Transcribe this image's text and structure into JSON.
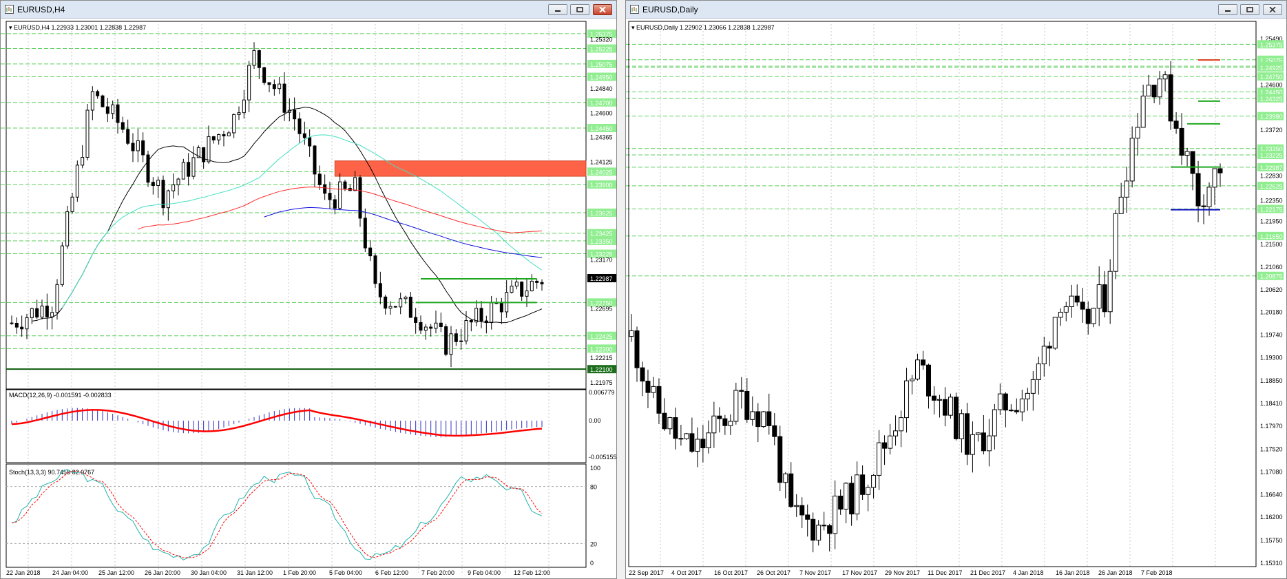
{
  "left_window": {
    "title": "EURUSD,H4",
    "header": "EURUSD,H4  1.22933 1.23001 1.22838 1.22987",
    "price_labels": [
      {
        "v": 1.2537,
        "t": "1.25375",
        "hl": true
      },
      {
        "v": 1.2532,
        "t": "1.25320",
        "hl": false
      },
      {
        "v": 1.25225,
        "t": "1.25225",
        "hl": true
      },
      {
        "v": 1.25075,
        "t": "1.25075",
        "hl": true
      },
      {
        "v": 1.2495,
        "t": "1.24950",
        "hl": true
      },
      {
        "v": 1.2484,
        "t": "1.24840",
        "hl": false
      },
      {
        "v": 1.247,
        "t": "1.24700",
        "hl": true
      },
      {
        "v": 1.246,
        "t": "1.24600",
        "hl": false
      },
      {
        "v": 1.2445,
        "t": "1.24450",
        "hl": true
      },
      {
        "v": 1.24365,
        "t": "1.24365",
        "hl": false
      },
      {
        "v": 1.24125,
        "t": "1.24125",
        "hl": false
      },
      {
        "v": 1.24025,
        "t": "1.24025",
        "hl": true
      },
      {
        "v": 1.239,
        "t": "1.23900",
        "hl": true
      },
      {
        "v": 1.23625,
        "t": "1.23625",
        "hl": true
      },
      {
        "v": 1.23425,
        "t": "1.23425",
        "hl": true
      },
      {
        "v": 1.2335,
        "t": "1.23350",
        "hl": true
      },
      {
        "v": 1.23225,
        "t": "1.23225",
        "hl": true
      },
      {
        "v": 1.2317,
        "t": "1.23170",
        "hl": false
      },
      {
        "v": 1.22987,
        "t": "1.22987",
        "hl": false,
        "cur": true
      },
      {
        "v": 1.2275,
        "t": "1.22750",
        "hl": true
      },
      {
        "v": 1.22695,
        "t": "1.22695",
        "hl": false
      },
      {
        "v": 1.22425,
        "t": "1.22425",
        "hl": true
      },
      {
        "v": 1.223,
        "t": "1.22300",
        "hl": true
      },
      {
        "v": 1.22215,
        "t": "1.22215",
        "hl": false
      },
      {
        "v": 1.221,
        "t": "1.22100",
        "hl": false,
        "green": true
      },
      {
        "v": 1.21975,
        "t": "1.21975",
        "hl": false
      }
    ],
    "macd": {
      "label": "MACD(12,26,9) -0.001591 -0.002833",
      "top": "0.006779",
      "zero": "0.00",
      "bottom": "-0.005155"
    },
    "stoch": {
      "label": "Stoch(13,3,3) 90.7458 82.0767",
      "levels": [
        "100",
        "80",
        "20",
        "0"
      ]
    },
    "time_labels": [
      "22 Jan 2018",
      "24 Jan 04:00",
      "25 Jan 12:00",
      "26 Jan 20:00",
      "30 Jan 04:00",
      "31 Jan 12:00",
      "1 Feb 20:00",
      "5 Feb 04:00",
      "6 Feb 12:00",
      "7 Feb 20:00",
      "9 Feb 04:00",
      "12 Feb 12:00"
    ]
  },
  "right_window": {
    "title": "EURUSD,Daily",
    "header": "EURUSD,Daily  1.22902 1.23066 1.22838 1.22987",
    "price_labels": [
      {
        "v": 1.2549,
        "t": "1.25490",
        "hl": false
      },
      {
        "v": 1.25375,
        "t": "1.25375",
        "hl": true
      },
      {
        "v": 1.25075,
        "t": "1.25075",
        "hl": true
      },
      {
        "v": 1.2495,
        "t": "1.24950",
        "hl": true
      },
      {
        "v": 1.24925,
        "t": "1.24925",
        "hl": true
      },
      {
        "v": 1.2475,
        "t": "1.24750",
        "hl": true
      },
      {
        "v": 1.246,
        "t": "1.24600",
        "hl": false
      },
      {
        "v": 1.2445,
        "t": "1.24450",
        "hl": true
      },
      {
        "v": 1.24325,
        "t": "1.24325",
        "hl": true
      },
      {
        "v": 1.2398,
        "t": "1.23980",
        "hl": true
      },
      {
        "v": 1.2372,
        "t": "1.23720",
        "hl": false
      },
      {
        "v": 1.2335,
        "t": "1.23350",
        "hl": true
      },
      {
        "v": 1.23225,
        "t": "1.23225",
        "hl": true
      },
      {
        "v": 1.22987,
        "t": "1.22987",
        "hl": true
      },
      {
        "v": 1.2283,
        "t": "1.22830",
        "hl": false
      },
      {
        "v": 1.22625,
        "t": "1.22625",
        "hl": true
      },
      {
        "v": 1.2235,
        "t": "1.22350",
        "hl": false
      },
      {
        "v": 1.22175,
        "t": "1.22175",
        "hl": true
      },
      {
        "v": 1.2195,
        "t": "1.21950",
        "hl": false
      },
      {
        "v": 1.2165,
        "t": "1.21650",
        "hl": true
      },
      {
        "v": 1.215,
        "t": "1.21500",
        "hl": false
      },
      {
        "v": 1.2106,
        "t": "1.21060",
        "hl": false
      },
      {
        "v": 1.20875,
        "t": "1.20875",
        "hl": true
      },
      {
        "v": 1.2062,
        "t": "1.20620",
        "hl": false
      },
      {
        "v": 1.2018,
        "t": "1.20180",
        "hl": false
      },
      {
        "v": 1.1974,
        "t": "1.19740",
        "hl": false
      },
      {
        "v": 1.193,
        "t": "1.19300",
        "hl": false
      },
      {
        "v": 1.1885,
        "t": "1.18850",
        "hl": false
      },
      {
        "v": 1.1841,
        "t": "1.18410",
        "hl": false
      },
      {
        "v": 1.1797,
        "t": "1.17970",
        "hl": false
      },
      {
        "v": 1.1752,
        "t": "1.17520",
        "hl": false
      },
      {
        "v": 1.1708,
        "t": "1.17080",
        "hl": false
      },
      {
        "v": 1.1664,
        "t": "1.16640",
        "hl": false
      },
      {
        "v": 1.162,
        "t": "1.16200",
        "hl": false
      },
      {
        "v": 1.1575,
        "t": "1.15750",
        "hl": false
      },
      {
        "v": 1.1531,
        "t": "1.15310",
        "hl": false
      }
    ],
    "time_labels": [
      "22 Sep 2017",
      "4 Oct 2017",
      "16 Oct 2017",
      "26 Oct 2017",
      "7 Nov 2017",
      "17 Nov 2017",
      "29 Nov 2017",
      "11 Dec 2017",
      "21 Dec 2017",
      "4 Jan 2018",
      "16 Jan 2018",
      "26 Jan 2018",
      "7 Feb 2018"
    ]
  },
  "colors": {
    "bull": "#ffffff",
    "bear": "#000000",
    "grid": "#c9c9c9",
    "level_green": "#1fa81f",
    "label_bg": "#90ee90",
    "zone": "#ff6347",
    "sma_black": "#000000",
    "sma_teal": "#40e0c0",
    "sma_red": "#ff2a2a",
    "sma_blue": "#1010e0",
    "macd_hist": "#3030c0",
    "macd_signal": "#ff0000",
    "stoch_main": "#20b2aa",
    "stoch_signal": "#ff0000"
  }
}
